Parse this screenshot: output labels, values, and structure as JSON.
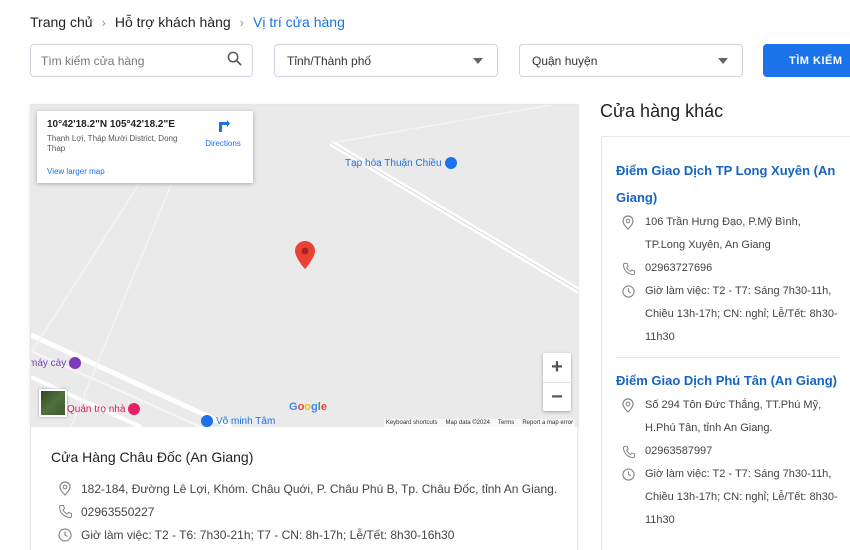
{
  "breadcrumb": {
    "items": [
      "Trang chủ",
      "Hỗ trợ khách hàng",
      "Vị trí cửa hàng"
    ],
    "separator": "›"
  },
  "search": {
    "placeholder": "Tìm kiếm cửa hàng",
    "province_select": "Tỉnh/Thành phố",
    "district_select": "Quận huyện",
    "button_label": "TÌM KIẾM"
  },
  "map": {
    "coordinates": "10°42'18.2\"N 105°42'18.2\"E",
    "place_address": "Thạnh Lợi, Tháp Mười District, Dong Thap",
    "directions_label": "Directions",
    "larger_map_label": "View larger map",
    "poi_1": "Tạp hóa Thuận Chiều",
    "poi_2": "máy cày",
    "poi_3": "Quán trọ nhà",
    "poi_4": "Võ minh Tâm",
    "google_logo": "Google",
    "footer": {
      "shortcuts": "Keyboard shortcuts",
      "map_data": "Map data ©2024",
      "terms": "Terms",
      "report": "Report a map error"
    },
    "zoom_in": "+",
    "zoom_out": "−"
  },
  "store": {
    "name": "Cửa Hàng Châu Đốc (An Giang)",
    "address": "182-184, Đường Lê Lợi, Khóm. Châu Quới,  P. Châu Phú B, Tp. Châu Đốc, tỉnh An Giang.",
    "phone": "02963550227",
    "hours": "Giờ làm việc: T2 - T6: 7h30-21h; T7 - CN: 8h-17h; Lễ/Tết: 8h30-16h30"
  },
  "other_stores": {
    "title": "Cửa hàng khác",
    "items": [
      {
        "name": "Điểm Giao Dịch TP Long Xuyên (An Giang)",
        "address": "106 Trần Hưng Đạo, P.Mỹ Bình, TP.Long Xuyên, An Giang",
        "phone": "02963727696",
        "hours": "Giờ làm việc: T2 - T7: Sáng 7h30-11h, Chiều 13h-17h; CN: nghỉ; Lễ/Tết: 8h30-11h30"
      },
      {
        "name": "Điểm Giao Dịch Phú Tân (An Giang)",
        "address": "Số 294 Tôn Đức Thắng, TT.Phú Mỹ, H.Phú Tân, tỉnh An Giang.",
        "phone": "02963587997",
        "hours": "Giờ làm việc: T2 - T7: Sáng 7h30-11h, Chiều 13h-17h; CN: nghỉ; Lễ/Tết: 8h30-11h30"
      }
    ]
  },
  "icons": {
    "search": "search-icon",
    "location": "location-pin-icon",
    "phone": "phone-icon",
    "clock": "clock-icon",
    "directions": "directions-icon"
  },
  "colors": {
    "accent": "#1a73e8",
    "link": "#1565c0",
    "map_pin": "#ea4335",
    "map_bg": "#eaeaea"
  }
}
